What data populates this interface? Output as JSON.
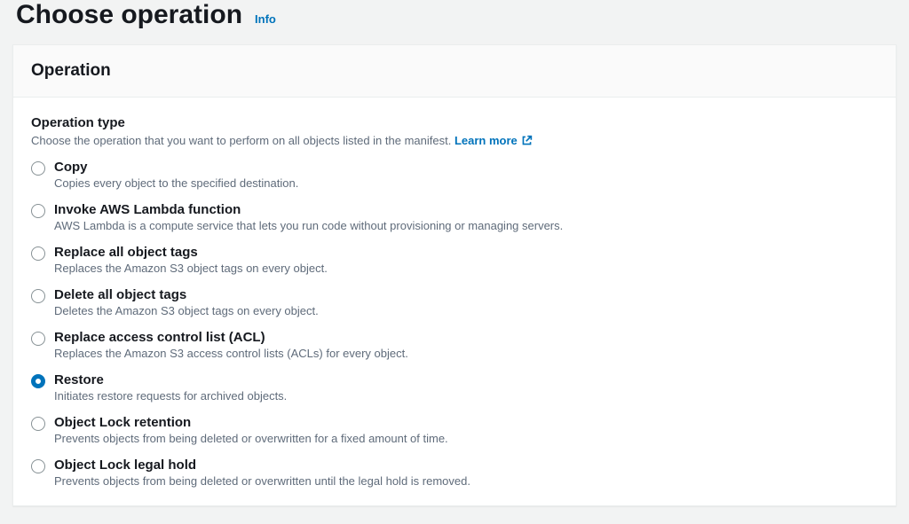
{
  "header": {
    "title": "Choose operation",
    "info": "Info"
  },
  "panel": {
    "title": "Operation",
    "sectionLabel": "Operation type",
    "sectionHelp": "Choose the operation that you want to perform on all objects listed in the manifest.",
    "learnMore": "Learn more",
    "selectedIndex": 5,
    "options": [
      {
        "label": "Copy",
        "description": "Copies every object to the specified destination."
      },
      {
        "label": "Invoke AWS Lambda function",
        "description": "AWS Lambda is a compute service that lets you run code without provisioning or managing servers."
      },
      {
        "label": "Replace all object tags",
        "description": "Replaces the Amazon S3 object tags on every object."
      },
      {
        "label": "Delete all object tags",
        "description": "Deletes the Amazon S3 object tags on every object."
      },
      {
        "label": "Replace access control list (ACL)",
        "description": "Replaces the Amazon S3 access control lists (ACLs) for every object."
      },
      {
        "label": "Restore",
        "description": "Initiates restore requests for archived objects."
      },
      {
        "label": "Object Lock retention",
        "description": "Prevents objects from being deleted or overwritten for a fixed amount of time."
      },
      {
        "label": "Object Lock legal hold",
        "description": "Prevents objects from being deleted or overwritten until the legal hold is removed."
      }
    ]
  }
}
